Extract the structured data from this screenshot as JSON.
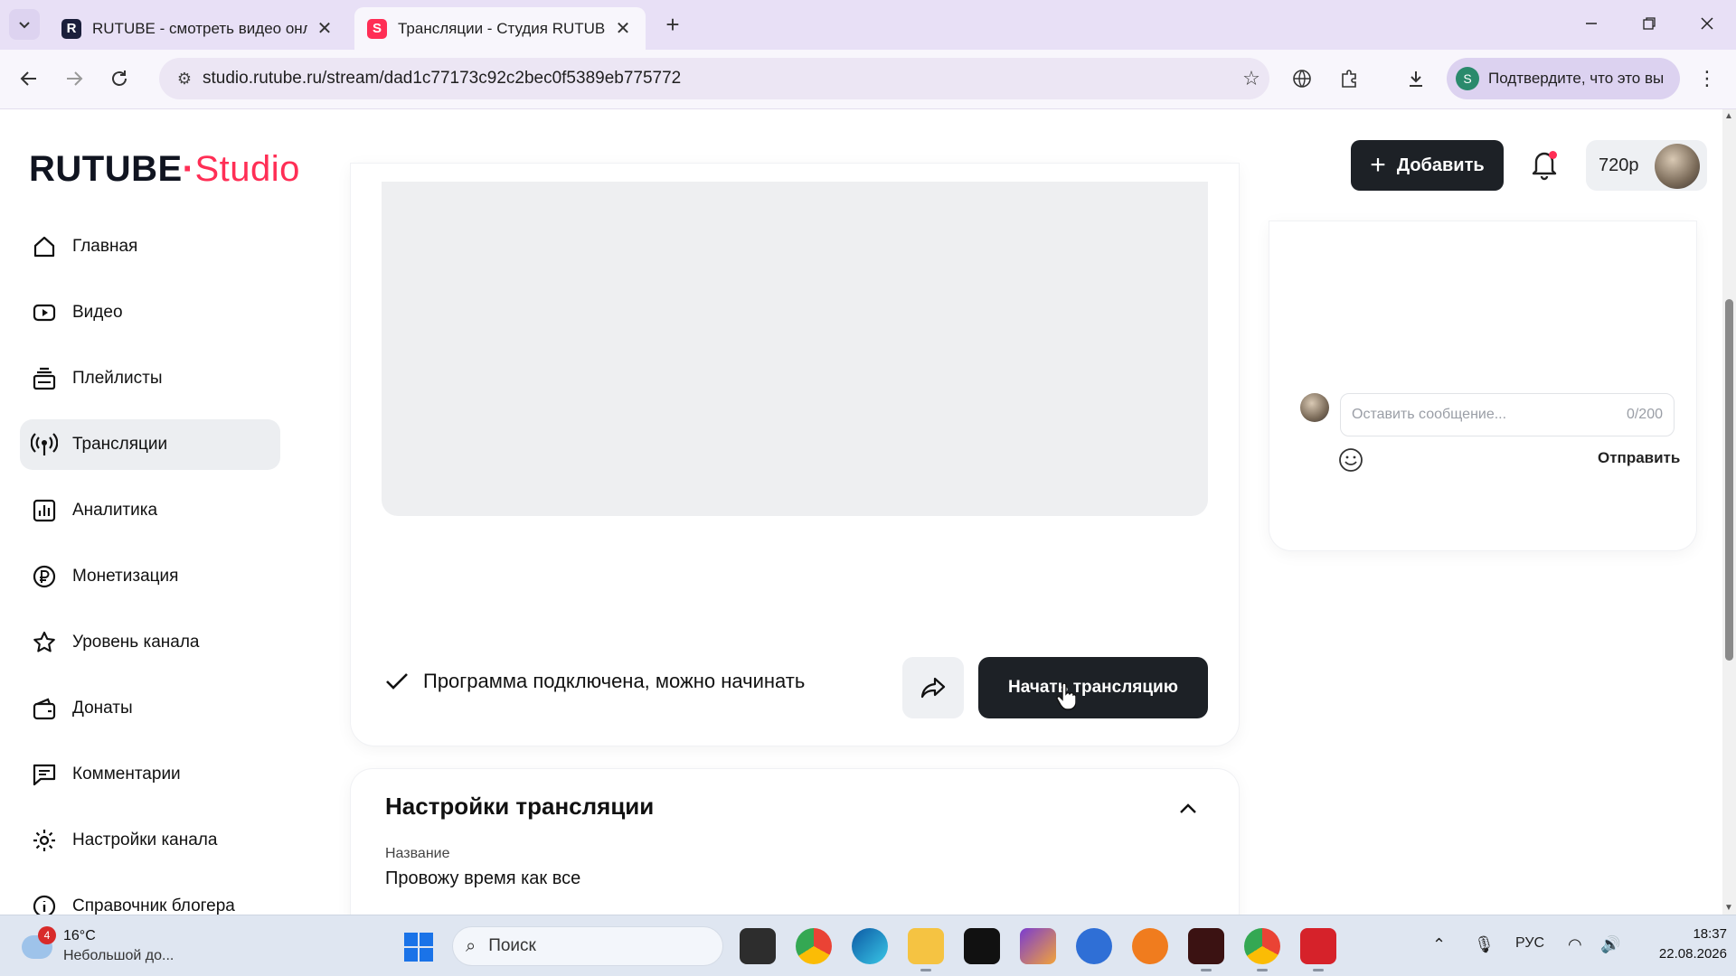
{
  "browser": {
    "tabs": [
      {
        "title": "RUTUBE - смотреть видео онл",
        "favicon": "R",
        "active": false
      },
      {
        "title": "Трансляции - Студия RUTUBE",
        "favicon": "S",
        "active": true
      }
    ],
    "url": "studio.rutube.ru/stream/dad1c77173c92c2bec0f5389eb775772",
    "verify_label": "Подтвердите, что это вы",
    "verify_badge": "S"
  },
  "header": {
    "logo_main": "RUTUBE",
    "logo_dot": "·",
    "logo_studio": "Studio",
    "add_label": "Добавить",
    "quality": "720p"
  },
  "sidebar": {
    "items": [
      {
        "label": "Главная",
        "icon": "home-icon"
      },
      {
        "label": "Видео",
        "icon": "video-icon"
      },
      {
        "label": "Плейлисты",
        "icon": "playlist-icon"
      },
      {
        "label": "Трансляции",
        "icon": "broadcast-icon",
        "active": true
      },
      {
        "label": "Аналитика",
        "icon": "analytics-icon"
      },
      {
        "label": "Монетизация",
        "icon": "ruble-icon"
      },
      {
        "label": "Уровень канала",
        "icon": "star-icon"
      },
      {
        "label": "Донаты",
        "icon": "wallet-icon"
      },
      {
        "label": "Комментарии",
        "icon": "comment-icon"
      },
      {
        "label": "Настройки канала",
        "icon": "gear-icon"
      },
      {
        "label": "Справочник блогера",
        "icon": "info-icon"
      }
    ]
  },
  "stream": {
    "status_text": "Программа подключена, можно начинать",
    "start_label": "Начать трансляцию"
  },
  "chat": {
    "placeholder": "Оставить сообщение...",
    "counter": "0/200",
    "send_label": "Отправить"
  },
  "settings": {
    "title": "Настройки трансляции",
    "name_label": "Название",
    "name_value": "Провожу время как все"
  },
  "taskbar": {
    "weather_temp": "16°C",
    "weather_desc": "Небольшой до...",
    "weather_badge": "4",
    "search_label": "Поиск",
    "lang": "РУС",
    "time": "18:37",
    "date": "22.08.2026"
  },
  "colors": {
    "brand_accent": "#ff2e55",
    "primary_button": "#1d2126",
    "tab_strip": "#e8e0f6"
  }
}
